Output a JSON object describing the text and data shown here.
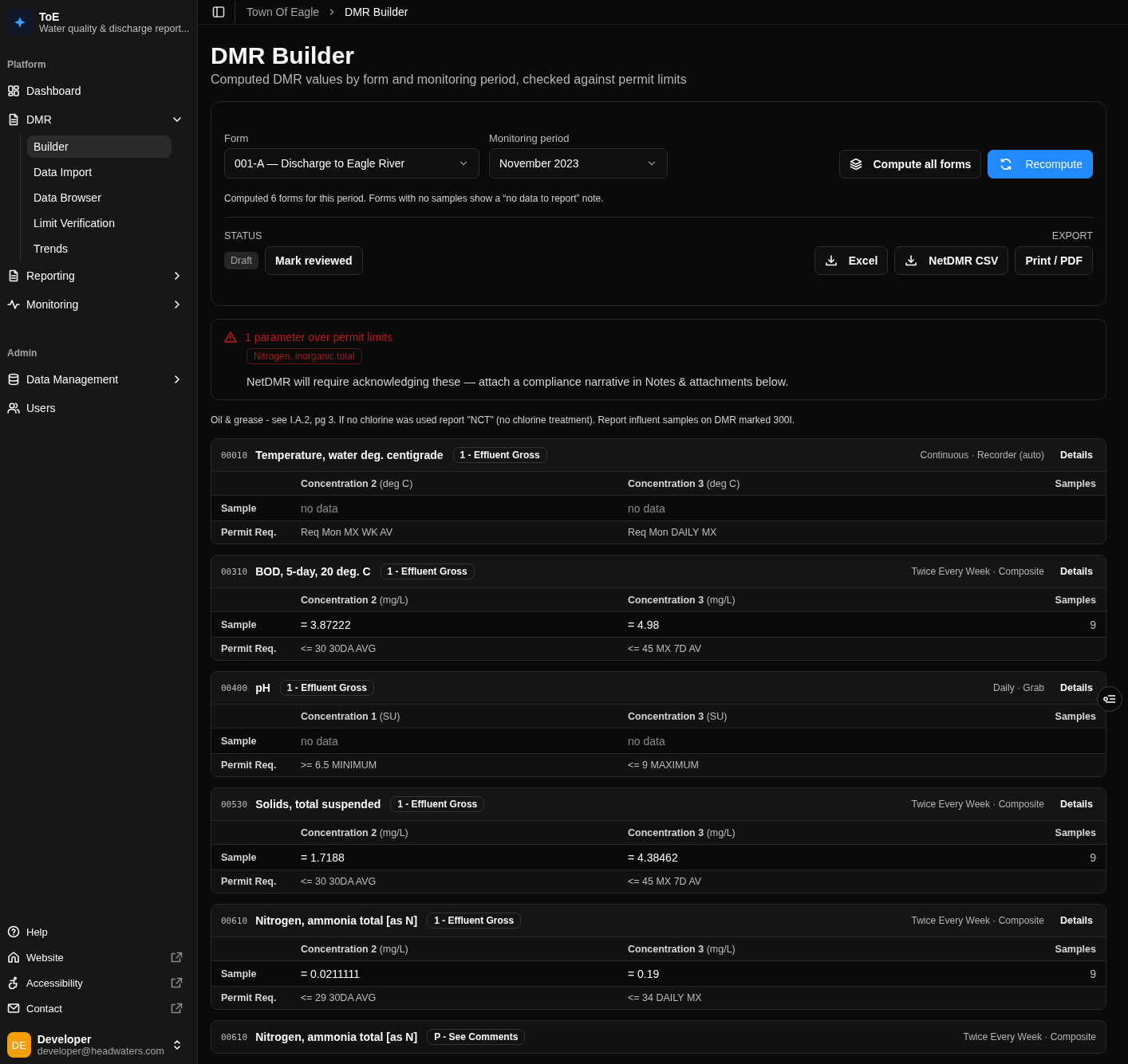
{
  "sidebar": {
    "app": {
      "name": "ToE",
      "subtitle": "Water quality & discharge report..."
    },
    "groups": [
      {
        "label": "Platform",
        "items": [
          {
            "label": "Dashboard"
          },
          {
            "label": "DMR",
            "expanded": true,
            "children": [
              {
                "label": "Builder",
                "selected": true
              },
              {
                "label": "Data Import",
                "selected": false
              },
              {
                "label": "Data Browser",
                "selected": false
              },
              {
                "label": "Limit Verification",
                "selected": false
              },
              {
                "label": "Trends",
                "selected": false
              }
            ]
          },
          {
            "label": "Reporting",
            "expanded": false
          },
          {
            "label": "Monitoring",
            "expanded": false
          }
        ]
      },
      {
        "label": "Admin",
        "items": [
          {
            "label": "Data Management",
            "expanded": false
          },
          {
            "label": "Users"
          }
        ]
      }
    ],
    "footer_links": [
      {
        "label": "Help"
      },
      {
        "label": "Website",
        "external": true
      },
      {
        "label": "Accessibility",
        "external": true
      },
      {
        "label": "Contact",
        "external": true
      }
    ],
    "user": {
      "initials": "DE",
      "name": "Developer",
      "email": "developer@headwaters.com"
    }
  },
  "breadcrumb": [
    {
      "label": "Town Of Eagle",
      "current": false
    },
    {
      "label": "DMR Builder",
      "current": true
    }
  ],
  "page": {
    "title": "DMR Builder",
    "subtitle": "Computed DMR values by form and monitoring period, checked against permit limits"
  },
  "controls": {
    "form": {
      "label": "Form",
      "value": "001-A — Discharge to Eagle River"
    },
    "period": {
      "label": "Monitoring period",
      "value": "November 2023"
    },
    "buttons": [
      {
        "label": "Compute all forms",
        "primary": false
      },
      {
        "label": "Recompute",
        "primary": true
      }
    ],
    "note": "Computed 6 forms for this period. Forms with no samples show a “no data to report” note.",
    "status": {
      "heading": "STATUS",
      "badge": "Draft",
      "action": "Mark reviewed"
    },
    "export": {
      "heading": "EXPORT",
      "buttons": [
        "Excel",
        "NetDMR CSV",
        "Print / PDF"
      ]
    }
  },
  "alert": {
    "title": "1 parameter over permit limits",
    "tags": [
      "Nitrogen, inorganic total"
    ],
    "message": "NetDMR will require acknowledging these — attach a compliance narrative in Notes & attachments below."
  },
  "form_note": "Oil & grease - see I.A.2, pg 3. If no chlorine was used report \"NCT\" (no chlorine treatment). Report influent samples on DMR marked 300I.",
  "parameters": [
    {
      "code": "00010",
      "name": "Temperature, water deg. centigrade",
      "location": "1 - Effluent Gross",
      "frequency": "Continuous · Recorder (auto)",
      "details": "Details",
      "columns": [
        {
          "name": "Concentration 2",
          "unit": "(deg C)"
        },
        {
          "name": "Concentration 3",
          "unit": "(deg C)"
        }
      ],
      "samples_heading": "Samples",
      "sample_label": "Sample",
      "sample": [
        {
          "text": "no data",
          "empty": true
        },
        {
          "text": "no data",
          "empty": true
        }
      ],
      "permit_label": "Permit Req.",
      "permit": [
        "Req Mon MX WK AV",
        "Req Mon DAILY MX"
      ]
    },
    {
      "code": "00310",
      "name": "BOD, 5-day, 20 deg. C",
      "location": "1 - Effluent Gross",
      "frequency": "Twice Every Week · Composite",
      "details": "Details",
      "columns": [
        {
          "name": "Concentration 2",
          "unit": "(mg/L)"
        },
        {
          "name": "Concentration 3",
          "unit": "(mg/L)"
        }
      ],
      "samples_heading": "Samples",
      "sample_label": "Sample",
      "sample": [
        {
          "text": "= 3.87222",
          "empty": false
        },
        {
          "text": "= 4.98",
          "empty": false
        }
      ],
      "count": "9",
      "permit_label": "Permit Req.",
      "permit": [
        "<= 30 30DA AVG",
        "<= 45 MX 7D AV"
      ]
    },
    {
      "code": "00400",
      "name": "pH",
      "location": "1 - Effluent Gross",
      "frequency": "Daily · Grab",
      "details": "Details",
      "columns": [
        {
          "name": "Concentration 1",
          "unit": "(SU)"
        },
        {
          "name": "Concentration 3",
          "unit": "(SU)"
        }
      ],
      "samples_heading": "Samples",
      "sample_label": "Sample",
      "sample": [
        {
          "text": "no data",
          "empty": true
        },
        {
          "text": "no data",
          "empty": true
        }
      ],
      "permit_label": "Permit Req.",
      "permit": [
        ">= 6.5 MINIMUM",
        "<= 9 MAXIMUM"
      ]
    },
    {
      "code": "00530",
      "name": "Solids, total suspended",
      "location": "1 - Effluent Gross",
      "frequency": "Twice Every Week · Composite",
      "details": "Details",
      "columns": [
        {
          "name": "Concentration 2",
          "unit": "(mg/L)"
        },
        {
          "name": "Concentration 3",
          "unit": "(mg/L)"
        }
      ],
      "samples_heading": "Samples",
      "sample_label": "Sample",
      "sample": [
        {
          "text": "= 1.7188",
          "empty": false
        },
        {
          "text": "= 4.38462",
          "empty": false
        }
      ],
      "count": "9",
      "permit_label": "Permit Req.",
      "permit": [
        "<= 30 30DA AVG",
        "<= 45 MX 7D AV"
      ]
    },
    {
      "code": "00610",
      "name": "Nitrogen, ammonia total [as N]",
      "location": "1 - Effluent Gross",
      "frequency": "Twice Every Week · Composite",
      "details": "Details",
      "columns": [
        {
          "name": "Concentration 2",
          "unit": "(mg/L)"
        },
        {
          "name": "Concentration 3",
          "unit": "(mg/L)"
        }
      ],
      "samples_heading": "Samples",
      "sample_label": "Sample",
      "sample": [
        {
          "text": "= 0.0211111",
          "empty": false
        },
        {
          "text": "= 0.19",
          "empty": false
        }
      ],
      "count": "9",
      "permit_label": "Permit Req.",
      "permit": [
        "<= 29 30DA AVG",
        "<= 34 DAILY MX"
      ]
    },
    {
      "code": "00610",
      "name": "Nitrogen, ammonia total [as N]",
      "location": "P - See Comments",
      "frequency": "Twice Every Week · Composite"
    }
  ]
}
